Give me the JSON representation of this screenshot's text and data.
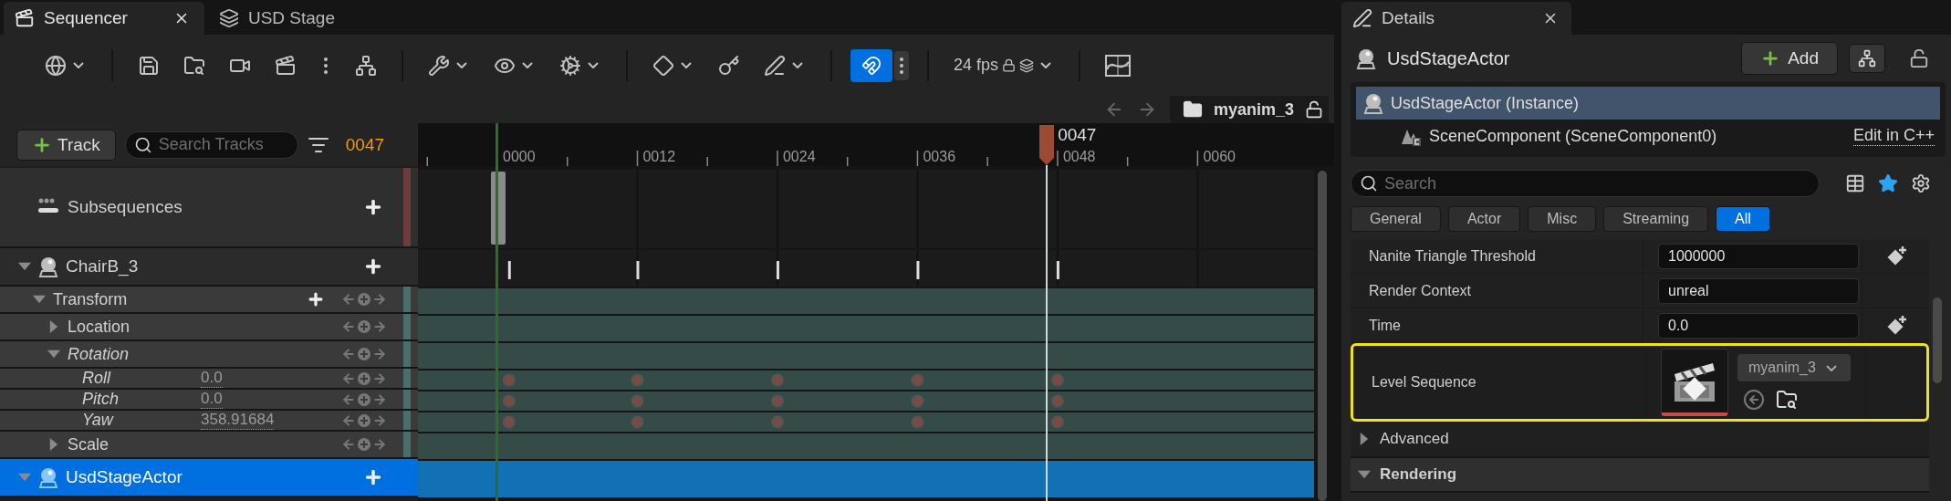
{
  "sequencer_tabs": [
    {
      "label": "Sequencer",
      "selected": true
    },
    {
      "label": "USD Stage",
      "selected": false
    }
  ],
  "toolbar": {
    "frame_rate": "24 fps",
    "snap_on": true
  },
  "breadcrumb": {
    "sequence": "myanim_3"
  },
  "track_bar": {
    "add_label": "Track",
    "search_placeholder": "Search Tracks",
    "current_frame": "0047"
  },
  "tracks": [
    {
      "kind": "subsequences",
      "label": "Subsequences",
      "color": "#6e3c3e"
    },
    {
      "kind": "actor",
      "label": "ChairB_3",
      "expanded": true,
      "selected": false,
      "children": [
        {
          "kind": "group",
          "label": "Transform",
          "expanded": true,
          "animated": false,
          "addable": true,
          "color": "#4a6f6b",
          "children": [
            {
              "kind": "group",
              "label": "Location",
              "expanded": false,
              "animated": false,
              "addable": false
            },
            {
              "kind": "group",
              "label": "Rotation",
              "expanded": true,
              "animated": true,
              "addable": false,
              "children": [
                {
                  "kind": "channel",
                  "label": "Roll",
                  "value": "0.0",
                  "animated": true
                },
                {
                  "kind": "channel",
                  "label": "Pitch",
                  "value": "0.0",
                  "animated": true
                },
                {
                  "kind": "channel",
                  "label": "Yaw",
                  "value": "358.91684",
                  "animated": true
                }
              ]
            },
            {
              "kind": "group",
              "label": "Scale",
              "expanded": false,
              "animated": false,
              "addable": false
            }
          ]
        }
      ]
    },
    {
      "kind": "actor",
      "label": "UsdStageActor",
      "expanded": true,
      "selected": true
    }
  ],
  "timeline": {
    "ruler_labels": [
      "0000",
      "0012",
      "0024",
      "0036",
      "0048",
      "0060"
    ],
    "playhead_label": "0047"
  },
  "details": {
    "tab": "Details",
    "actor": "UsdStageActor",
    "add_label": "Add",
    "components": [
      {
        "label": "UsdStageActor (Instance)",
        "selected": true
      },
      {
        "label": "SceneComponent (SceneComponent0)",
        "selected": false,
        "link": "Edit in C++"
      }
    ],
    "search_placeholder": "Search",
    "favorites_on": true,
    "filters": [
      {
        "label": "General",
        "selected": false
      },
      {
        "label": "Actor",
        "selected": false
      },
      {
        "label": "Misc",
        "selected": false
      },
      {
        "label": "Streaming",
        "selected": false
      },
      {
        "label": "All",
        "selected": true
      }
    ],
    "properties": [
      {
        "kind": "text",
        "label": "Nanite Triangle Threshold",
        "value": "1000000",
        "keyable": true,
        "highlighted": false
      },
      {
        "kind": "text",
        "label": "Render Context",
        "value": "unreal",
        "keyable": false,
        "highlighted": false
      },
      {
        "kind": "text",
        "label": "Time",
        "value": "0.0",
        "keyable": true,
        "highlighted": false
      },
      {
        "kind": "asset",
        "label": "Level Sequence",
        "asset": "myanim_3",
        "keyable": false,
        "highlighted": true
      }
    ],
    "sections": [
      {
        "label": "Advanced",
        "expanded": false
      },
      {
        "label": "Rendering",
        "expanded": true
      }
    ]
  }
}
